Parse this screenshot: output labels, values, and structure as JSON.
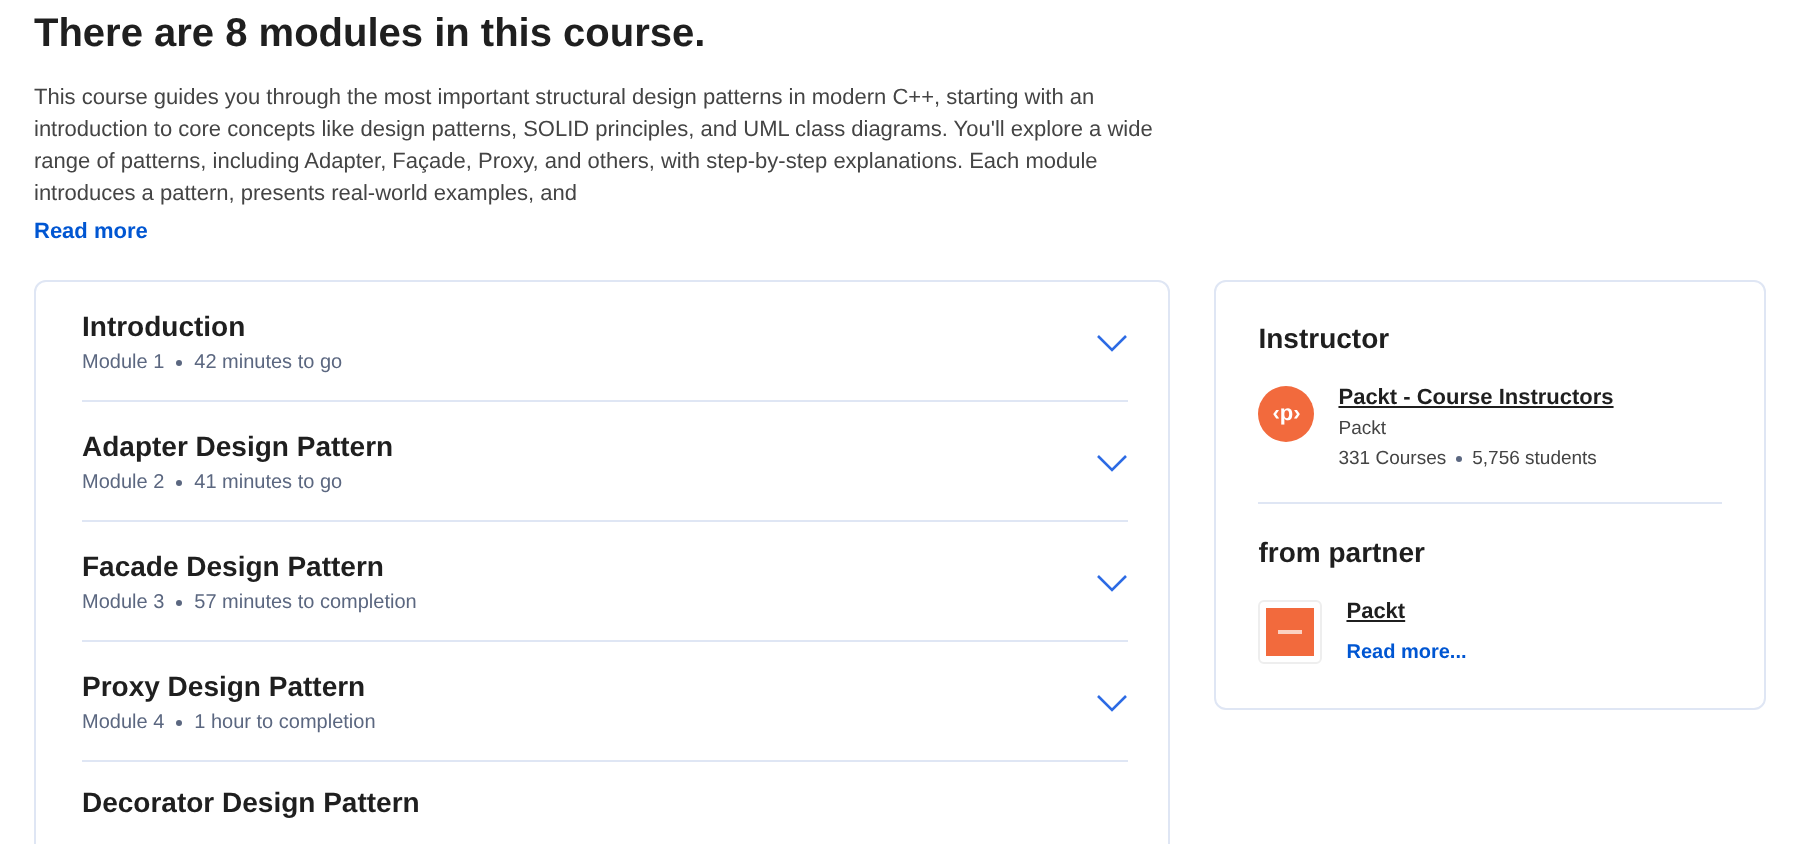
{
  "heading": "There are 8 modules in this course.",
  "description": "This course guides you through the most important structural design patterns in modern C++, starting with an introduction to core concepts like design patterns, SOLID principles, and UML class diagrams. You'll explore a wide range of patterns, including Adapter, Façade, Proxy, and others, with step-by-step explanations. Each module introduces a pattern, presents real-world examples, and",
  "read_more": "Read more",
  "modules": [
    {
      "title": "Introduction",
      "number": "Module 1",
      "duration": "42 minutes to go",
      "expanded": false
    },
    {
      "title": "Adapter Design Pattern",
      "number": "Module 2",
      "duration": "41 minutes to go",
      "expanded": false
    },
    {
      "title": "Facade Design Pattern",
      "number": "Module 3",
      "duration": "57 minutes to completion",
      "expanded": false
    },
    {
      "title": "Proxy Design Pattern",
      "number": "Module 4",
      "duration": "1 hour to completion",
      "expanded": false
    },
    {
      "title": "Decorator Design Pattern"
    }
  ],
  "instructor": {
    "heading": "Instructor",
    "logo_text": "‹p›",
    "name": "Packt - Course Instructors",
    "org": "Packt",
    "courses": "331 Courses",
    "students": "5,756 students"
  },
  "partner": {
    "heading": "from partner",
    "name": "Packt",
    "read_more": "Read more..."
  }
}
